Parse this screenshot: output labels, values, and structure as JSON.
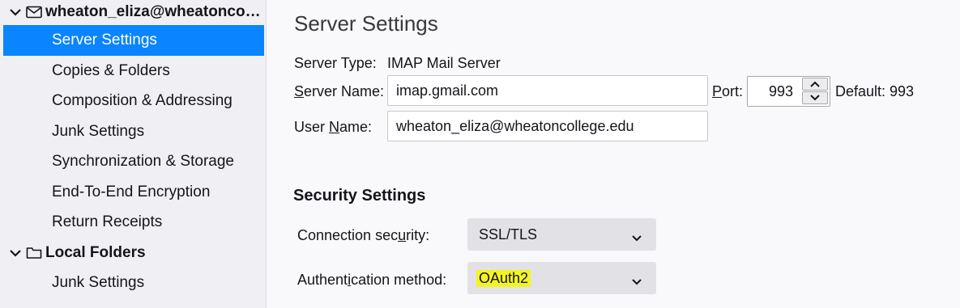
{
  "sidebar": {
    "account_header": "wheaton_eliza@wheatoncoll...",
    "account_items": [
      {
        "label": "Server Settings",
        "selected": true
      },
      {
        "label": "Copies & Folders"
      },
      {
        "label": "Composition & Addressing"
      },
      {
        "label": "Junk Settings"
      },
      {
        "label": "Synchronization & Storage"
      },
      {
        "label": "End-To-End Encryption"
      },
      {
        "label": "Return Receipts"
      }
    ],
    "local_header": "Local Folders",
    "local_items": [
      {
        "label": "Junk Settings"
      }
    ],
    "icons": [
      "chevron-down-icon",
      "mail-icon",
      "folder-icon"
    ]
  },
  "main": {
    "title": "Server Settings",
    "server_type_label": "Server Type:",
    "server_type_value": "IMAP Mail Server",
    "server_name_label_u": "S",
    "server_name_label_rest": "erver Name:",
    "server_name_value": "imap.gmail.com",
    "port_label_u": "P",
    "port_label_rest": "ort:",
    "port_value": "993",
    "default_text": "Default: 993",
    "user_name_label_pre": "User ",
    "user_name_label_u": "N",
    "user_name_label_rest": "ame:",
    "user_name_value": "wheaton_eliza@wheatoncollege.edu",
    "security_title": "Security Settings",
    "connection_label_pre": "Connection sec",
    "connection_label_u": "u",
    "connection_label_rest": "rity:",
    "connection_value": "SSL/TLS",
    "auth_label_pre": "Authent",
    "auth_label_u": "i",
    "auth_label_rest": "cation method:",
    "auth_value": "OAuth2",
    "highlight_color": "#f4f423",
    "selection_color": "#0a84ff"
  }
}
